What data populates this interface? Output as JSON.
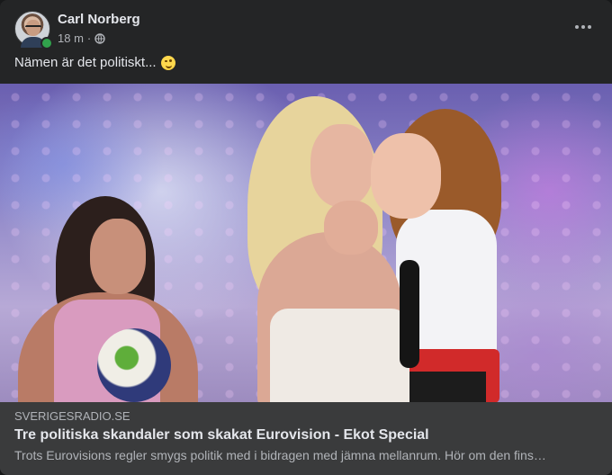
{
  "post": {
    "author": "Carl Norberg",
    "time": "18 m",
    "separator": "·",
    "audience_icon": "globe-icon",
    "text": "Nämen är det politiskt...",
    "emoji": "winking-face-emoji"
  },
  "link_preview": {
    "domain": "SVERIGESRADIO.SE",
    "title": "Tre politiska skandaler som skakat Eurovision - Ekot Special",
    "description": "Trots Eurovisions regler smygs politik med i bidragen med jämna mellanrum. Hör om den fins…"
  },
  "colors": {
    "card_bg": "#242526",
    "preview_bg": "#3a3b3c",
    "primary_text": "#e4e6eb",
    "secondary_text": "#b0b3b8",
    "online": "#31a24c"
  }
}
